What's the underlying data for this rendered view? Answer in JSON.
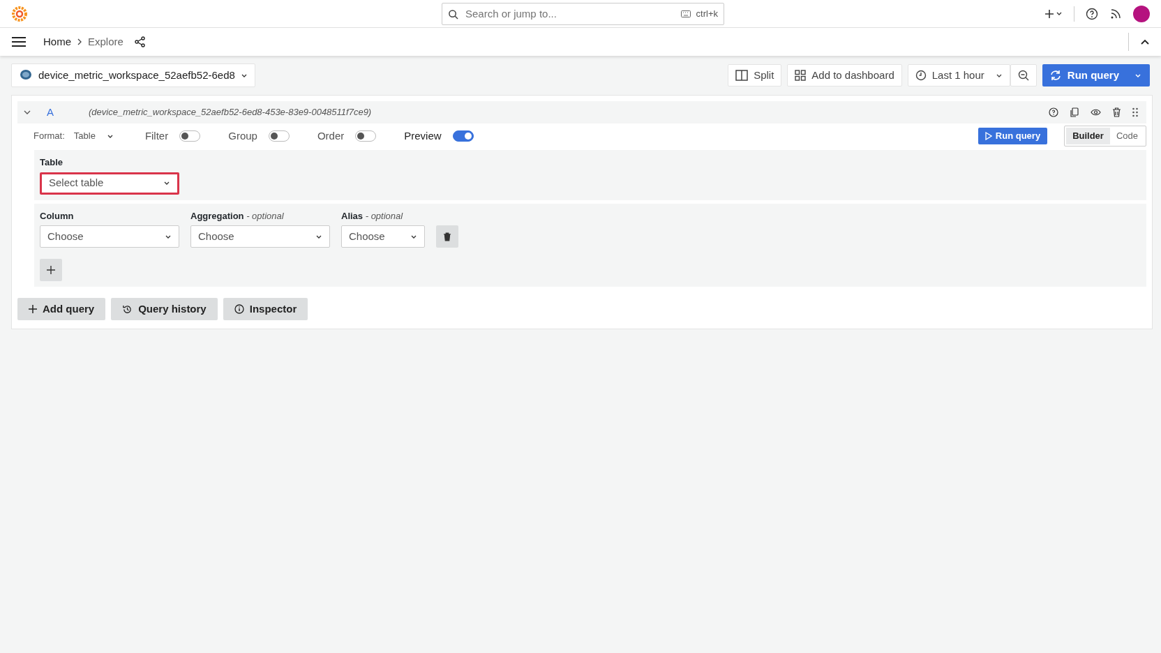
{
  "topbar": {
    "search": {
      "placeholder": "Search or jump to...",
      "shortcut": "ctrl+k"
    }
  },
  "breadcrumbs": [
    {
      "text": "Home",
      "current": false
    },
    {
      "text": "Explore",
      "current": true
    }
  ],
  "datasource": "device_metric_workspace_52aefb52-6ed8",
  "toolbar": {
    "split": "Split",
    "add_to_dashboard": "Add to dashboard",
    "time_range": "Last 1 hour",
    "run_query": "Run query"
  },
  "query": {
    "ref": "A",
    "expanded": true,
    "datasource_name": "(device_metric_workspace_52aefb52-6ed8-453e-83e9-0048511f7ce9)",
    "format": {
      "label": "Format:",
      "value": "Table"
    },
    "toggles": [
      {
        "label": "Filter",
        "on": false
      },
      {
        "label": "Group",
        "on": false
      },
      {
        "label": "Order",
        "on": false
      },
      {
        "label": "Preview",
        "on": true
      }
    ],
    "run_query": "Run query",
    "modes": [
      {
        "label": "Builder",
        "selected": true
      },
      {
        "label": "Code",
        "selected": false
      }
    ],
    "table": {
      "label": "Table",
      "placeholder": "Select table",
      "invalid": true
    },
    "columns": [
      {
        "label": "Column",
        "placeholder": "Choose"
      },
      {
        "label": "Aggregation",
        "hint": "- optional",
        "placeholder": "Choose"
      },
      {
        "label": "Alias",
        "hint": "- optional",
        "placeholder": "Choose"
      }
    ]
  },
  "actions": [
    {
      "kind": "add",
      "label": "Add query"
    },
    {
      "kind": "history",
      "label": "Query history"
    },
    {
      "kind": "info",
      "label": "Inspector"
    }
  ]
}
